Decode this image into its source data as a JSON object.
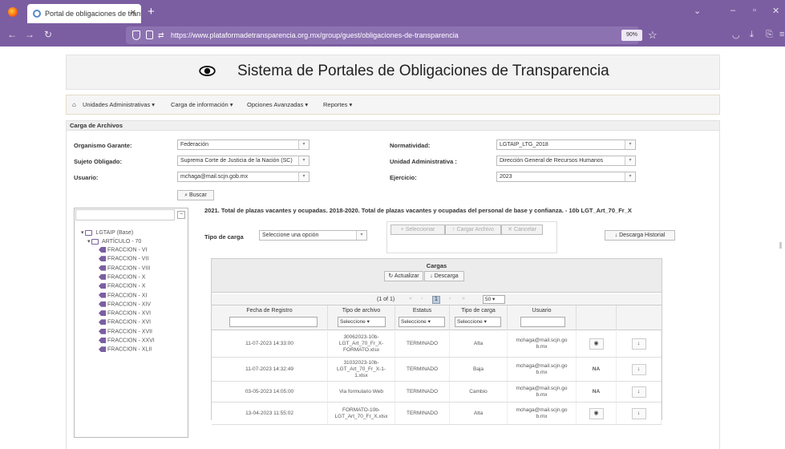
{
  "browser": {
    "tab_title": "Portal de obligaciones de trans",
    "url": "https://www.plataformadetransparencia.org.mx/group/guest/obligaciones-de-transparencia",
    "zoom": "90%"
  },
  "header": {
    "title": "Sistema de Portales de Obligaciones de Transparencia"
  },
  "menu": {
    "items": [
      {
        "label": "Unidades Administrativas ▾"
      },
      {
        "label": "Carga de información ▾"
      },
      {
        "label": "Opciones Avanzadas ▾"
      },
      {
        "label": "Reportes ▾"
      }
    ]
  },
  "panel": {
    "title": "Carga de Archivos"
  },
  "form": {
    "organismo_label": "Organismo Garante:",
    "organismo_value": "Federación",
    "sujeto_label": "Sujeto Obligado:",
    "sujeto_value": "Suprema Corte de Justicia de la Nación (SC)",
    "usuario_label": "Usuario:",
    "usuario_value": "mchaga@mail.scjn.gob.mx",
    "normatividad_label": "Normatividad:",
    "normatividad_value": "LGTAIP_LTG_2018",
    "unidad_label": "Unidad Administrativa :",
    "unidad_value": "Dirección General de Recursos Humanos",
    "ejercicio_label": "Ejercicio:",
    "ejercicio_value": "2023",
    "buscar_label": "Buscar"
  },
  "tree": {
    "root": "LGTAIP (Base)",
    "article": "ARTÍCULO - 70",
    "fracciones": [
      "FRACCION - VI",
      "FRACCION - VII",
      "FRACCION - VIII",
      "FRACCION - X",
      "FRACCION - X",
      "FRACCION - XI",
      "FRACCION - XIV",
      "FRACCION - XVI",
      "FRACCION - XVI",
      "FRACCION - XVII",
      "FRACCION - XXVI",
      "FRACCION - XLII"
    ]
  },
  "section": {
    "title": "2021. Total de plazas vacantes y ocupadas. 2018-2020. Total de plazas vacantes y ocupadas del personal de base y confianza. - 10b LGT_Art_70_Fr_X"
  },
  "carga": {
    "tipo_label": "Tipo de carga",
    "tipo_value": "Seleccione una opción",
    "seleccionar": "Seleccionar",
    "cargar_archivo": "Cargar Archivo",
    "cancelar": "Cancelar",
    "descarga_historial": "Descarga Historial"
  },
  "table": {
    "title": "Cargas",
    "actualizar": "Actualizar",
    "descarga": "Descarga",
    "page_info": "(1 of 1)",
    "current_page": "1",
    "per_page": "50",
    "columns": [
      "Fecha de Registro",
      "Tipo de archivo",
      "Estatus",
      "Tipo de carga",
      "Usuario"
    ],
    "filter_select": "Seleccione",
    "rows": [
      {
        "fecha": "11-07-2023 14:33:00",
        "archivo": "30062023-10b-LGT_Art_70_Fr_X-FORMATO.xlsx",
        "estatus": "TERMINADO",
        "carga": "Alta",
        "usuario": "mchaga@mail.scjn.go b.mx",
        "accion": "eye",
        "extra": "↓"
      },
      {
        "fecha": "11-07-2023 14:32:49",
        "archivo": "31032023-10b-LGT_Art_70_Fr_X-1-1.xlsx",
        "estatus": "TERMINADO",
        "carga": "Baja",
        "usuario": "mchaga@mail.scjn.go b.mx",
        "accion": "NA",
        "extra": "↓"
      },
      {
        "fecha": "03-05-2023 14:05:00",
        "archivo": "Via formulario Web",
        "estatus": "TERMINADO",
        "carga": "Cambio",
        "usuario": "mchaga@mail.scjn.go b.mx",
        "accion": "NA",
        "extra": "↓"
      },
      {
        "fecha": "13-04-2023 11:55:02",
        "archivo": "FORMATO-10b-LGT_Art_70_Fr_X.xlsx",
        "estatus": "TERMINADO",
        "carga": "Alta",
        "usuario": "mchaga@mail.scjn.go b.mx",
        "accion": "eye",
        "extra": "↓"
      }
    ]
  }
}
